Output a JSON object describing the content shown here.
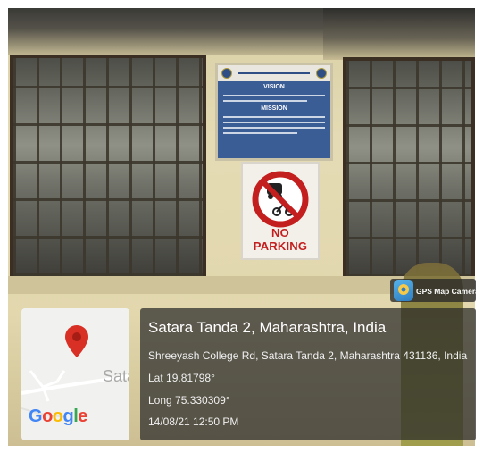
{
  "scene": {
    "subject": "College building wall with vision/mission board and No Parking sign",
    "sign_text": "NO PARKING",
    "board": {
      "heading": "VISION",
      "subheading": "MISSION"
    }
  },
  "overlay": {
    "gps_badge": {
      "label": "GPS Map Camera",
      "icon": "gps-map-camera-icon"
    },
    "map": {
      "place_text": "Sata",
      "brand": "Google",
      "pin_icon": "map-pin-icon"
    },
    "location_title": "Satara Tanda 2, Maharashtra, India",
    "address": "Shreeyash College Rd, Satara Tanda 2, Maharashtra 431136, India",
    "lat": "Lat 19.81798°",
    "long": "Long 75.330309°",
    "timestamp": "14/08/21 12:50 PM"
  },
  "colors": {
    "wall": "#e2d7ad",
    "board_blue": "#3b5d96",
    "sign_red": "#c41f1f",
    "overlay_bg": "#282828",
    "pin_red": "#d93025"
  }
}
